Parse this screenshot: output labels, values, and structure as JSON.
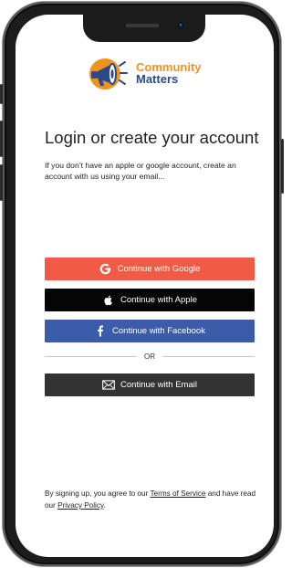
{
  "logo": {
    "line1": "Community",
    "line2": "Matters"
  },
  "heading": "Login or create your account",
  "subtext": "If you don’t have an apple or google account, create an account with us using your email...",
  "buttons": {
    "google": "Continue with Google",
    "apple": "Continue with Apple",
    "facebook": "Continue with Facebook",
    "email": "Continue with Email"
  },
  "divider_label": "OR",
  "terms": {
    "prefix": "By signing up, you agree to our ",
    "terms_link": "Terms of Service",
    "middle": " and have read our ",
    "privacy_link": "Privacy Policy",
    "suffix": "."
  },
  "icons": {
    "google": "google-g-icon",
    "apple": "apple-icon",
    "facebook": "facebook-f-icon",
    "email": "envelope-icon",
    "logo": "megaphone-icon"
  },
  "colors": {
    "google": "#f15a45",
    "apple": "#050505",
    "facebook": "#3b5ca8",
    "email": "#333333",
    "brand_orange": "#f0921e",
    "brand_blue": "#2c4a8a"
  }
}
